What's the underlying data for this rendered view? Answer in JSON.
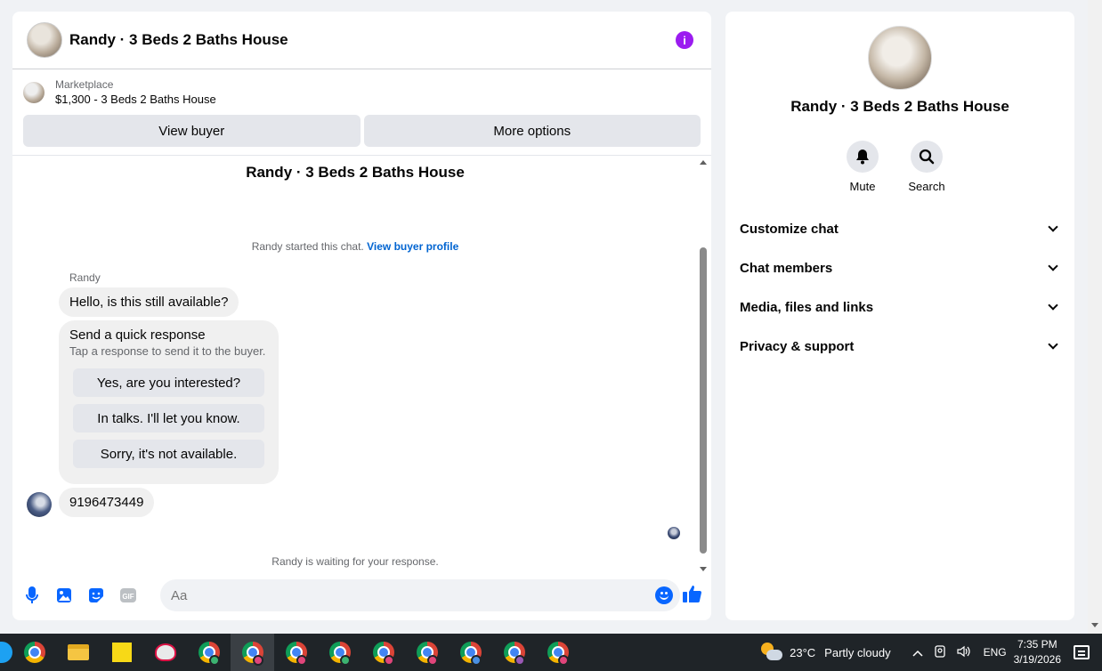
{
  "chat": {
    "header_title": "Randy · 3 Beds 2 Baths House",
    "listing": {
      "category": "Marketplace",
      "title": "$1,300 - 3 Beds 2 Baths House",
      "view_buyer": "View buyer",
      "more_options": "More options"
    },
    "conversation_title": "Randy · 3 Beds 2 Baths House",
    "system_text": "Randy started this chat.",
    "system_link": "View buyer profile",
    "sender_name": "Randy",
    "message1": "Hello, is this still available?",
    "quick_response": {
      "title": "Send a quick response",
      "subtitle": "Tap a response to send it to the buyer.",
      "options": [
        "Yes, are you interested?",
        "In talks. I'll let you know.",
        "Sorry, it's not available."
      ]
    },
    "message2": "9196473449",
    "waiting_text": "Randy is waiting for your response.",
    "composer_placeholder": "Aa",
    "accent_color": "#0866ff",
    "info_color": "#9b1cf0"
  },
  "side": {
    "title": "Randy · 3 Beds 2 Baths House",
    "actions": [
      {
        "label": "Mute",
        "icon": "bell-icon"
      },
      {
        "label": "Search",
        "icon": "search-icon"
      }
    ],
    "menu": [
      "Customize chat",
      "Chat members",
      "Media, files and links",
      "Privacy & support"
    ]
  },
  "taskbar": {
    "weather_temp": "23°C",
    "weather_text": "Partly cloudy",
    "language": "ENG",
    "time": "7:35 PM",
    "date": "3/19/2026"
  }
}
